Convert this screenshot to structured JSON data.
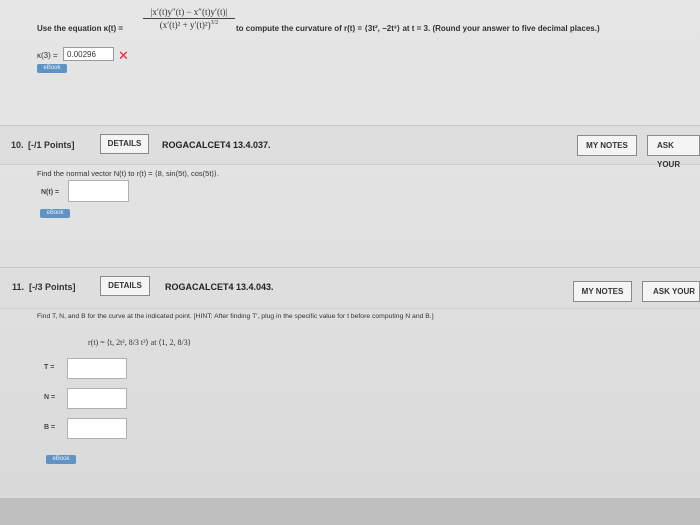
{
  "q9": {
    "intro": "Use the equation κ(t) =",
    "formula_num": "|x′(t)y″(t) − x″(t)y′(t)|",
    "formula_den": "(x′(t)² + y′(t)²)",
    "formula_exp": "3/2",
    "tail": "to compute the curvature of r(t) = ⟨3t², −2t³⟩ at t = 3. (Round your answer to five decimal places.)",
    "answer_label": "κ(3) =",
    "answer_value": "0.00296",
    "wrong_mark": "✕",
    "ebook": "eBook"
  },
  "q10": {
    "number": "10.",
    "points": "[-/1 Points]",
    "details": "DETAILS",
    "code": "ROGACALCET4 13.4.037.",
    "my_notes": "MY NOTES",
    "ask": "ASK YOUR",
    "prompt": "Find the normal vector N(t) to r(t) = ⟨8, sin(5t), cos(5t)⟩.",
    "answer_label": "N(t) =",
    "ebook": "eBook"
  },
  "q11": {
    "number": "11.",
    "points": "[-/3 Points]",
    "details": "DETAILS",
    "code": "ROGACALCET4 13.4.043.",
    "my_notes": "MY NOTES",
    "ask": "ASK YOUR",
    "prompt": "Find T, N, and B for the curve at the indicated point. [HINT: After finding T′, plug in the specific value for t before computing N and B.]",
    "curve": "r(t) = ⟨t, 2t², 8/3 t³⟩ at ⟨1, 2, 8/3⟩",
    "t_label": "T =",
    "n_label": "N =",
    "b_label": "B =",
    "ebook": "eBook"
  }
}
